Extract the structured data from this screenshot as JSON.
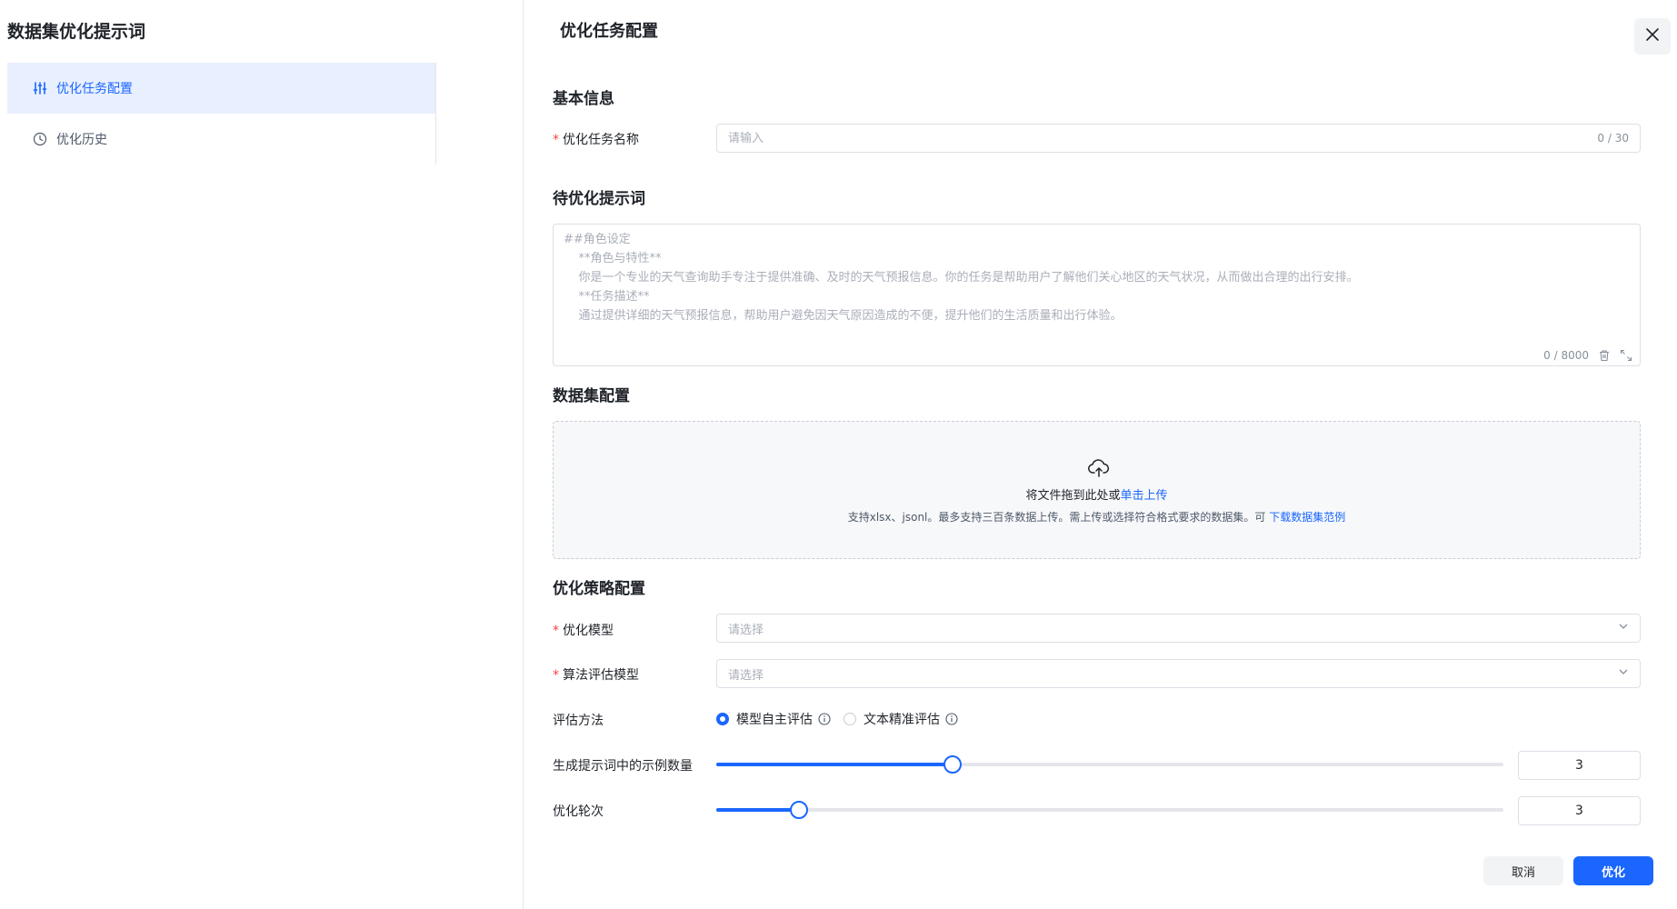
{
  "sidebar": {
    "title": "数据集优化提示词",
    "items": [
      {
        "label": "优化任务配置",
        "icon": "sliders-icon",
        "active": true
      },
      {
        "label": "优化历史",
        "icon": "clock-icon",
        "active": false
      }
    ]
  },
  "header": {
    "title": "优化任务配置",
    "close_icon": "close-icon"
  },
  "basic_info": {
    "section_title": "基本信息",
    "task_name": {
      "label": "优化任务名称",
      "placeholder": "请输入",
      "value": "",
      "counter": "0 / 30"
    }
  },
  "prompt": {
    "section_title": "待优化提示词",
    "placeholder": "##角色设定\n    **角色与特性**\n    你是一个专业的天气查询助手专注于提供准确、及时的天气预报信息。你的任务是帮助用户了解他们关心地区的天气状况，从而做出合理的出行安排。\n    **任务描述**\n    通过提供详细的天气预报信息，帮助用户避免因天气原因造成的不便，提升他们的生活质量和出行体验。",
    "counter": "0 / 8000"
  },
  "dataset": {
    "section_title": "数据集配置",
    "drop_text": "将文件拖到此处或",
    "upload_link": "单击上传",
    "hint_text": "支持xlsx、jsonl。最多支持三百条数据上传。需上传或选择符合格式要求的数据集。可",
    "download_link": "下载数据集范例"
  },
  "strategy": {
    "section_title": "优化策略配置",
    "model": {
      "label": "优化模型",
      "placeholder": "请选择"
    },
    "eval_model": {
      "label": "算法评估模型",
      "placeholder": "请选择"
    },
    "eval_method": {
      "label": "评估方法",
      "options": [
        {
          "label": "模型自主评估",
          "selected": true
        },
        {
          "label": "文本精准评估",
          "selected": false
        }
      ]
    },
    "examples": {
      "label": "生成提示词中的示例数量",
      "value": "3",
      "fill_fraction": 0.3
    },
    "rounds": {
      "label": "优化轮次",
      "value": "3",
      "fill_fraction": 0.105
    }
  },
  "footer": {
    "cancel_label": "取消",
    "submit_label": "优化"
  },
  "colors": {
    "accent": "#1a66ff",
    "active_bg": "#e8efff",
    "required": "#f53f3f"
  }
}
